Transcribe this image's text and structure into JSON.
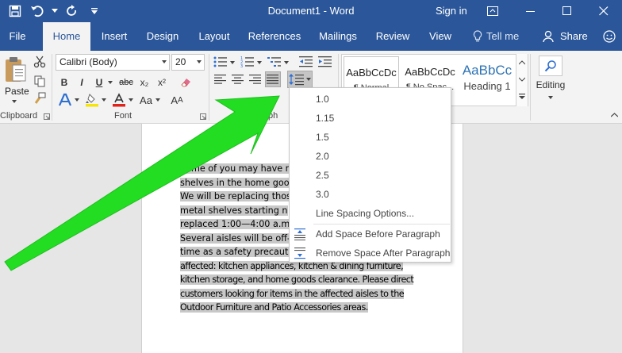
{
  "titlebar": {
    "document_title": "Document1 - Word",
    "signin_label": "Sign in",
    "colors": {
      "background": "#2b579a"
    }
  },
  "tabs": [
    {
      "label": "File"
    },
    {
      "label": "Home"
    },
    {
      "label": "Insert"
    },
    {
      "label": "Design"
    },
    {
      "label": "Layout"
    },
    {
      "label": "References"
    },
    {
      "label": "Mailings"
    },
    {
      "label": "Review"
    },
    {
      "label": "View"
    }
  ],
  "tellme": {
    "label": "Tell me"
  },
  "share": {
    "label": "Share"
  },
  "ribbon": {
    "clipboard": {
      "paste_label": "Paste",
      "group_label": "Clipboard"
    },
    "font": {
      "font_name": "Calibri (Body)",
      "font_size": "20",
      "group_label": "Font",
      "bold": "B",
      "italic": "I",
      "underline": "U",
      "strikethrough": "abc",
      "subscript": "x₂",
      "superscript": "x²",
      "change_case": "Aa"
    },
    "paragraph": {
      "group_label": "ph"
    },
    "styles": [
      {
        "sample": "AaBbCcDc",
        "name": "¶ Normal"
      },
      {
        "sample": "AaBbCcDc",
        "name": "¶ No Spac..."
      },
      {
        "sample": "AaBbCc",
        "name": "Heading 1"
      }
    ],
    "editing": {
      "label": "Editing"
    }
  },
  "document": {
    "lines": [
      "Some of you may have n",
      "shelves in the home good",
      "We will be replacing thos",
      "metal shelves starting n",
      "replaced 1:00—4:00 a.m.",
      "Several aisles will be off-",
      "time as a safety precauti",
      "affected: kitchen appliances, kitchen & dining furniture,",
      "kitchen storage, and home goods clearance. Please direct",
      "customers looking for items in the affected aisles to the",
      "Outdoor Furniture and Patio Accessories areas."
    ]
  },
  "line_spacing_menu": {
    "options": [
      "1.0",
      "1.15",
      "1.5",
      "2.0",
      "2.5",
      "3.0"
    ],
    "line_spacing_options": "Line Spacing Options...",
    "add_space_before": "Add Space Before Paragraph",
    "remove_space_after": "Remove Space After Paragraph"
  },
  "annotation": {
    "arrow_color": "#22dd22"
  }
}
